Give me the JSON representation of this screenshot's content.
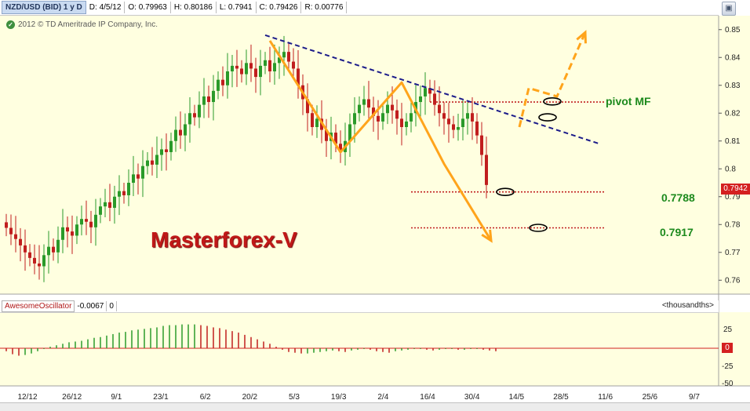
{
  "header": {
    "symbol": "NZD/USD (BID) 1 y D",
    "date": "D: 4/5/12",
    "open": "O: 0.79963",
    "high": "H: 0.80186",
    "low": "L: 0.7941",
    "close": "C: 0.79426",
    "range": "R: 0.00776"
  },
  "copyright": "2012 © TD Ameritrade IP Company, Inc.",
  "watermark": "Masterforex-V",
  "annotations": {
    "pivot_label": "pivot MF",
    "level1": "0.7788",
    "level2": "0.7917"
  },
  "current_price": "0.7942",
  "oscillator": {
    "name": "AwesomeOscillator",
    "value": "-0.0067",
    "extra": "0",
    "units": "<thousandths>",
    "zero_label": "0",
    "ticks": [
      "25",
      "-25",
      "-50"
    ]
  },
  "colors": {
    "bg": "#ffffe0",
    "up": "#2a9a2a",
    "down": "#c01e1e",
    "pattern": "#ffa41b",
    "trend": "#1c1c8a",
    "level": "#c02020",
    "label_green": "#1d8a1d",
    "watermark": "#c01818"
  },
  "chart_data": {
    "type": "candlestick",
    "instrument": "NZD/USD (BID)",
    "ylim": [
      0.755,
      0.855
    ],
    "yticks": [
      0.76,
      0.77,
      0.78,
      0.79,
      0.8,
      0.81,
      0.82,
      0.83,
      0.84,
      0.85
    ],
    "ytick_labels": [
      "0.76",
      "0.77",
      "0.78",
      "0.79",
      "0.8",
      "0.81",
      "0.82",
      "0.83",
      "0.84",
      "0.85"
    ],
    "xtick_labels": [
      "12/12",
      "26/12",
      "9/1",
      "23/1",
      "6/2",
      "20/2",
      "5/3",
      "19/3",
      "2/4",
      "16/4",
      "30/4",
      "14/5",
      "28/5",
      "11/6",
      "25/6",
      "9/7"
    ],
    "bars": 103,
    "closes": [
      0.7788,
      0.7765,
      0.7748,
      0.7725,
      0.77,
      0.768,
      0.766,
      0.765,
      0.769,
      0.772,
      0.77,
      0.7745,
      0.779,
      0.7775,
      0.776,
      0.78,
      0.782,
      0.781,
      0.779,
      0.7835,
      0.7865,
      0.788,
      0.786,
      0.79,
      0.792,
      0.7905,
      0.795,
      0.798,
      0.7965,
      0.801,
      0.803,
      0.8015,
      0.805,
      0.807,
      0.806,
      0.81,
      0.814,
      0.812,
      0.816,
      0.82,
      0.8185,
      0.823,
      0.826,
      0.824,
      0.828,
      0.832,
      0.83,
      0.835,
      0.837,
      0.836,
      0.834,
      0.838,
      0.836,
      0.833,
      0.837,
      0.839,
      0.835,
      0.838,
      0.84,
      0.842,
      0.8385,
      0.836,
      0.83,
      0.825,
      0.82,
      0.815,
      0.818,
      0.814,
      0.81,
      0.813,
      0.809,
      0.806,
      0.81,
      0.816,
      0.82,
      0.823,
      0.825,
      0.822,
      0.819,
      0.817,
      0.82,
      0.823,
      0.821,
      0.818,
      0.815,
      0.817,
      0.82,
      0.824,
      0.826,
      0.829,
      0.827,
      0.823,
      0.82,
      0.818,
      0.816,
      0.814,
      0.815,
      0.818,
      0.82,
      0.817,
      0.812,
      0.805,
      0.7942
    ],
    "pattern_path": [
      [
        0.846,
        56
      ],
      [
        0.806,
        71
      ],
      [
        0.831,
        84
      ],
      [
        0.8018,
        93
      ],
      [
        0.7742,
        103
      ]
    ],
    "pattern_target": [
      [
        0.815,
        109
      ],
      [
        0.829,
        111
      ],
      [
        0.826,
        117
      ],
      [
        0.849,
        123
      ]
    ],
    "trendline": [
      [
        0.848,
        55
      ],
      [
        0.809,
        126
      ]
    ],
    "levels": [
      {
        "label": "pivot MF",
        "value": 0.824,
        "x_from": 90,
        "x_to": 127
      },
      {
        "label": "0.7788",
        "value": 0.7917,
        "x_from": 86,
        "x_to": 127
      },
      {
        "label": "0.7917",
        "value": 0.7788,
        "x_from": 86,
        "x_to": 127
      }
    ],
    "oscillator_values": [
      -4,
      -8,
      -10,
      -9,
      -7,
      -4,
      -1,
      2,
      4,
      6,
      8,
      9,
      10,
      12,
      14,
      15,
      17,
      19,
      21,
      22,
      24,
      25,
      26,
      27,
      28,
      30,
      31,
      31,
      32,
      32,
      32,
      31,
      30,
      28,
      27,
      25,
      23,
      21,
      18,
      15,
      12,
      9,
      6,
      2,
      -2,
      -5,
      -6,
      -7,
      -7,
      -6,
      -5,
      -4,
      -3,
      -4,
      -5,
      -3,
      -2,
      -1,
      -2,
      -4,
      -5,
      -6,
      -4,
      -3,
      -2,
      -1,
      -1,
      -2,
      -3,
      -2,
      -1,
      -1,
      -2,
      -2,
      -1,
      -1,
      -2,
      -3,
      -4
    ]
  }
}
